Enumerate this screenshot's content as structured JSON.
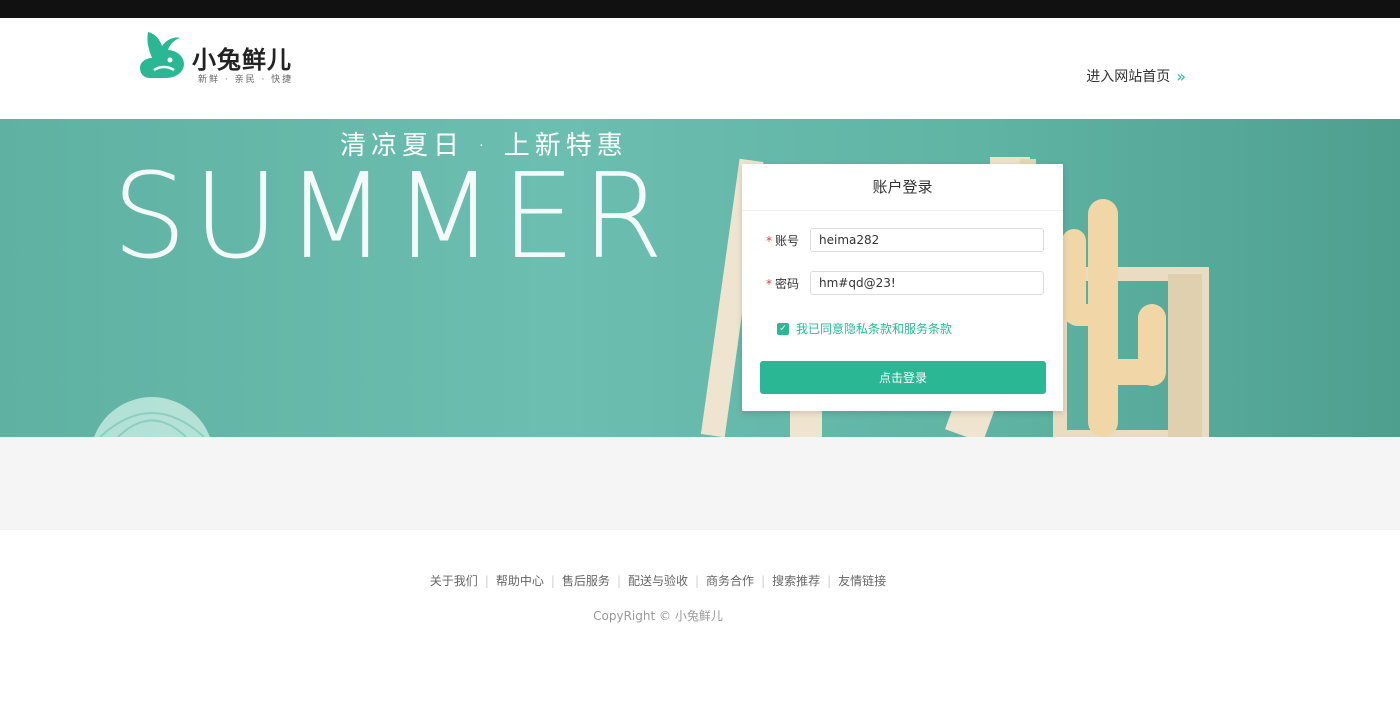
{
  "header": {
    "logo_name": "小兔鲜儿",
    "logo_slogan": "新鲜 · 亲民 · 快捷",
    "home_link": "进入网站首页",
    "home_chevron": "»"
  },
  "banner": {
    "subtitle": "清凉夏日 · 上新特惠",
    "title": "SUMMER"
  },
  "login": {
    "title": "账户登录",
    "account_label": "账号",
    "account_value": "heima282",
    "password_label": "密码",
    "password_value": "hm#qd@23!",
    "required_mark": "*",
    "agree_text": "我已同意隐私条款和服务条款",
    "agree_checked": true,
    "submit_label": "点击登录"
  },
  "footer": {
    "links": [
      "关于我们",
      "帮助中心",
      "售后服务",
      "配送与验收",
      "商务合作",
      "搜索推荐",
      "友情链接"
    ],
    "copyright": "CopyRight © 小兔鲜儿"
  },
  "colors": {
    "brand": "#2ab894",
    "banner_bg": "#66b9aa",
    "top_bar": "#111111",
    "footer_band": "#f5f5f5"
  }
}
